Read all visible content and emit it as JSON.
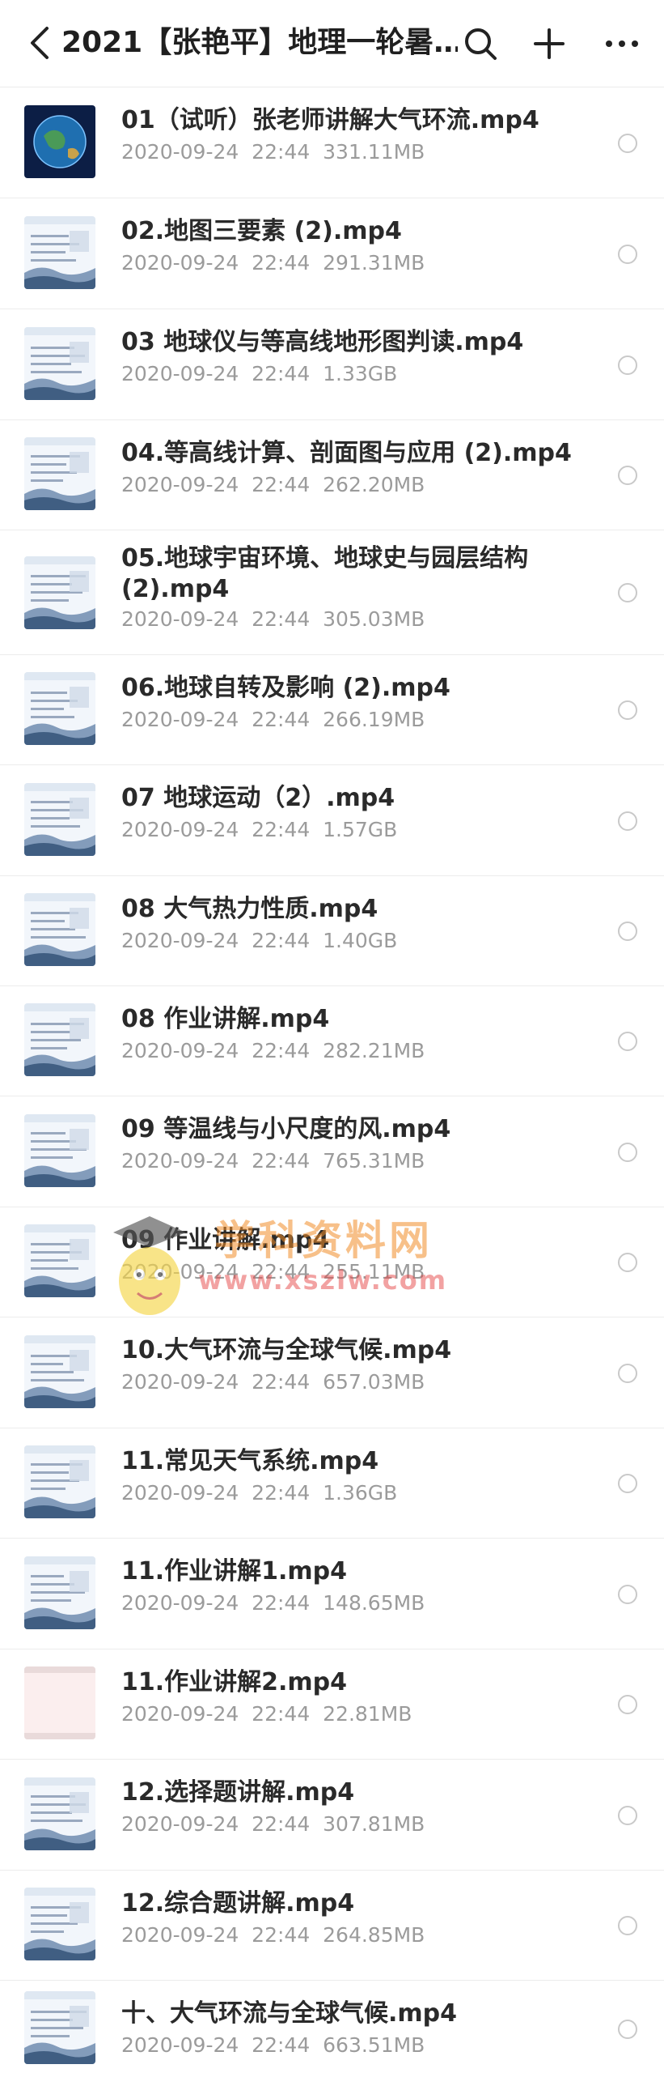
{
  "header": {
    "title": "2021【张艳平】地理一轮暑…",
    "back_icon": "chevron-left-icon",
    "search_icon": "search-icon",
    "add_icon": "plus-icon",
    "more_icon": "more-dots-icon"
  },
  "files": [
    {
      "name": "01（试听）张老师讲解大气环流.mp4",
      "date": "2020-09-24  22:44",
      "size": "331.11MB",
      "thumb": "earth"
    },
    {
      "name": "02.地图三要素 (2).mp4",
      "date": "2020-09-24  22:44",
      "size": "291.31MB",
      "thumb": "slide"
    },
    {
      "name": "03 地球仪与等高线地形图判读.mp4",
      "date": "2020-09-24  22:44",
      "size": "1.33GB",
      "thumb": "slide"
    },
    {
      "name": "04.等高线计算、剖面图与应用 (2).mp4",
      "date": "2020-09-24  22:44",
      "size": "262.20MB",
      "thumb": "slide"
    },
    {
      "name": "05.地球宇宙环境、地球史与园层结构 (2).mp4",
      "date": "2020-09-24  22:44",
      "size": "305.03MB",
      "thumb": "slide"
    },
    {
      "name": "06.地球自转及影响 (2).mp4",
      "date": "2020-09-24  22:44",
      "size": "266.19MB",
      "thumb": "slide"
    },
    {
      "name": "07  地球运动（2）.mp4",
      "date": "2020-09-24  22:44",
      "size": "1.57GB",
      "thumb": "slide"
    },
    {
      "name": "08 大气热力性质.mp4",
      "date": "2020-09-24  22:44",
      "size": "1.40GB",
      "thumb": "slide"
    },
    {
      "name": "08 作业讲解.mp4",
      "date": "2020-09-24  22:44",
      "size": "282.21MB",
      "thumb": "slide"
    },
    {
      "name": "09 等温线与小尺度的风.mp4",
      "date": "2020-09-24  22:44",
      "size": "765.31MB",
      "thumb": "slide"
    },
    {
      "name": "09 作业讲解.mp4",
      "date": "2020-09-24  22:44",
      "size": "255.11MB",
      "thumb": "slide"
    },
    {
      "name": "10.大气环流与全球气候.mp4",
      "date": "2020-09-24  22:44",
      "size": "657.03MB",
      "thumb": "slide"
    },
    {
      "name": "11.常见天气系统.mp4",
      "date": "2020-09-24  22:44",
      "size": "1.36GB",
      "thumb": "slide"
    },
    {
      "name": "11.作业讲解1.mp4",
      "date": "2020-09-24  22:44",
      "size": "148.65MB",
      "thumb": "slide"
    },
    {
      "name": "11.作业讲解2.mp4",
      "date": "2020-09-24  22:44",
      "size": "22.81MB",
      "thumb": "blank"
    },
    {
      "name": "12.选择题讲解.mp4",
      "date": "2020-09-24  22:44",
      "size": "307.81MB",
      "thumb": "slide"
    },
    {
      "name": "12.综合题讲解.mp4",
      "date": "2020-09-24  22:44",
      "size": "264.85MB",
      "thumb": "slide"
    },
    {
      "name": "十、大气环流与全球气候.mp4",
      "date": "2020-09-24  22:44",
      "size": "663.51MB",
      "thumb": "slide"
    }
  ],
  "watermark": {
    "title": "学科资料网",
    "url": "www.xszlw.com"
  },
  "colors": {
    "background": "#f7f7f8",
    "row": "#ffffff",
    "text": "#2a2a2a",
    "meta": "#9b9b9b",
    "divider": "#ececec"
  }
}
